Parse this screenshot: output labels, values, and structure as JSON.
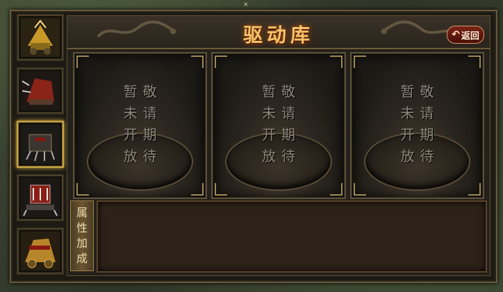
{
  "top_fragment": "×",
  "sidebar": {
    "items": [
      {
        "name": "chariot-gold-icon",
        "active": false
      },
      {
        "name": "chariot-red-icon",
        "active": false
      },
      {
        "name": "chariot-spiked-icon",
        "active": true
      },
      {
        "name": "chariot-red-spiked-icon",
        "active": false
      },
      {
        "name": "chariot-golden-icon",
        "active": false
      }
    ]
  },
  "header": {
    "title": "驱动库",
    "back_label": "返回",
    "back_icon": "return-arrow-icon"
  },
  "slots": [
    {
      "line1": [
        "暂",
        "未",
        "开",
        "放"
      ],
      "line2": [
        "敬",
        "请",
        "期",
        "待"
      ]
    },
    {
      "line1": [
        "暂",
        "未",
        "开",
        "放"
      ],
      "line2": [
        "敬",
        "请",
        "期",
        "待"
      ]
    },
    {
      "line1": [
        "暂",
        "未",
        "开",
        "放"
      ],
      "line2": [
        "敬",
        "请",
        "期",
        "待"
      ]
    }
  ],
  "attributes": {
    "tab_chars": [
      "属",
      "性",
      "加",
      "成"
    ],
    "content": ""
  },
  "colors": {
    "title": "#f3c46a",
    "pending_text": "#8f877a",
    "active_border": "#c9a640",
    "back_button": "#7a2418"
  }
}
